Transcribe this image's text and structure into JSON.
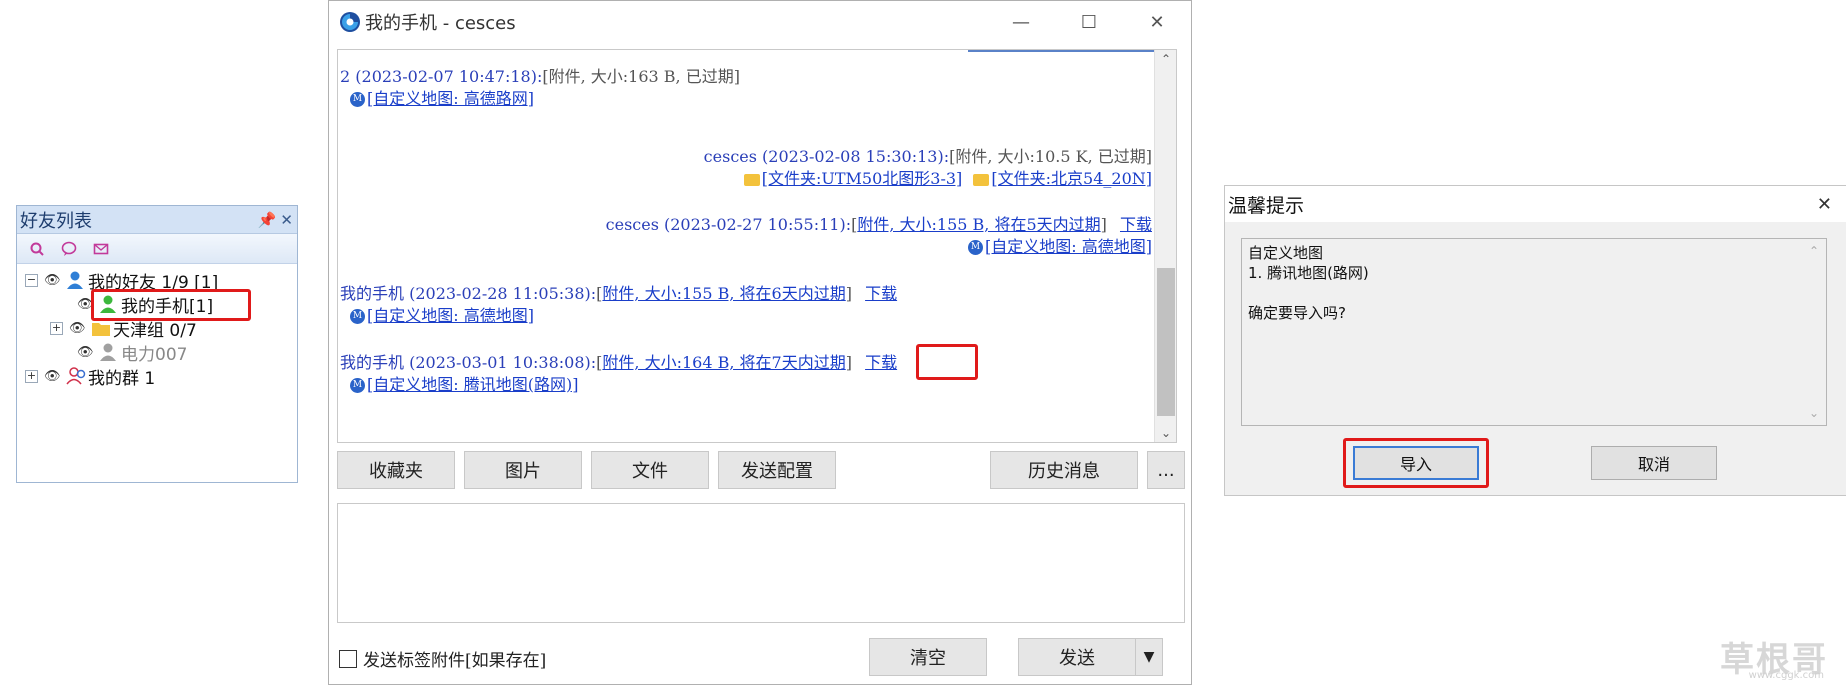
{
  "friend_panel": {
    "title": "好友列表",
    "groups": [
      {
        "label": "我的好友 1/9 [1]",
        "expanded": "−"
      },
      {
        "label": "我的手机[1]"
      },
      {
        "label": "天津组 0/7",
        "expanded": "+"
      },
      {
        "label": "电力007"
      },
      {
        "label": "我的群 1",
        "expanded": "+"
      }
    ]
  },
  "chat_window": {
    "title": "我的手机 - cesces",
    "messages": [
      {
        "header": "2 (2023-02-07 10:47:18):",
        "attach": "[附件, 大小:163 B, 已过期]",
        "link": "[自定义地图: 高德路网]"
      },
      {
        "header": "cesces (2023-02-08 15:30:13):",
        "attach": "[附件, 大小:10.5 K, 已过期]",
        "link1": "[文件夹:UTM50北图形3-3]",
        "link2": "[文件夹:北京54_20N]"
      },
      {
        "header": "cesces (2023-02-27 10:55:11):",
        "attach_prefix": "[",
        "attach": "附件, 大小:155 B, 将在5天内过期",
        "attach_suffix": "]",
        "download": "下载",
        "link": "[自定义地图: 高德地图]"
      },
      {
        "header": "我的手机 (2023-02-28 11:05:38):",
        "attach_prefix": "[",
        "attach": "附件, 大小:155 B, 将在6天内过期",
        "attach_suffix": "]",
        "download": "下载",
        "link": "[自定义地图: 高德地图]"
      },
      {
        "header": "我的手机 (2023-03-01 10:38:08):",
        "attach_prefix": "[",
        "attach": "附件, 大小:164 B, 将在7天内过期",
        "attach_suffix": "]",
        "download": "下载",
        "link": "[自定义地图: 腾讯地图(路网)]"
      }
    ],
    "toolbar": {
      "favorites": "收藏夹",
      "pictures": "图片",
      "files": "文件",
      "send_config": "发送配置",
      "history": "历史消息",
      "more": "..."
    },
    "send_tag_attachment": "发送标签附件[如果存在]",
    "clear": "清空",
    "send": "发送",
    "send_dropdown": "▼"
  },
  "dialog": {
    "title": "温馨提示",
    "close": "✕",
    "line1": "自定义地图",
    "line2": "1. 腾讯地图(路网)",
    "line3": "确定要导入吗?",
    "import": "导入",
    "cancel": "取消"
  },
  "watermark": {
    "text": "草根哥",
    "url": "www.cggk.com"
  },
  "colors": {
    "highlight": "#e01a1a",
    "link": "#1a3ec9",
    "sender": "#2a3fb8"
  }
}
